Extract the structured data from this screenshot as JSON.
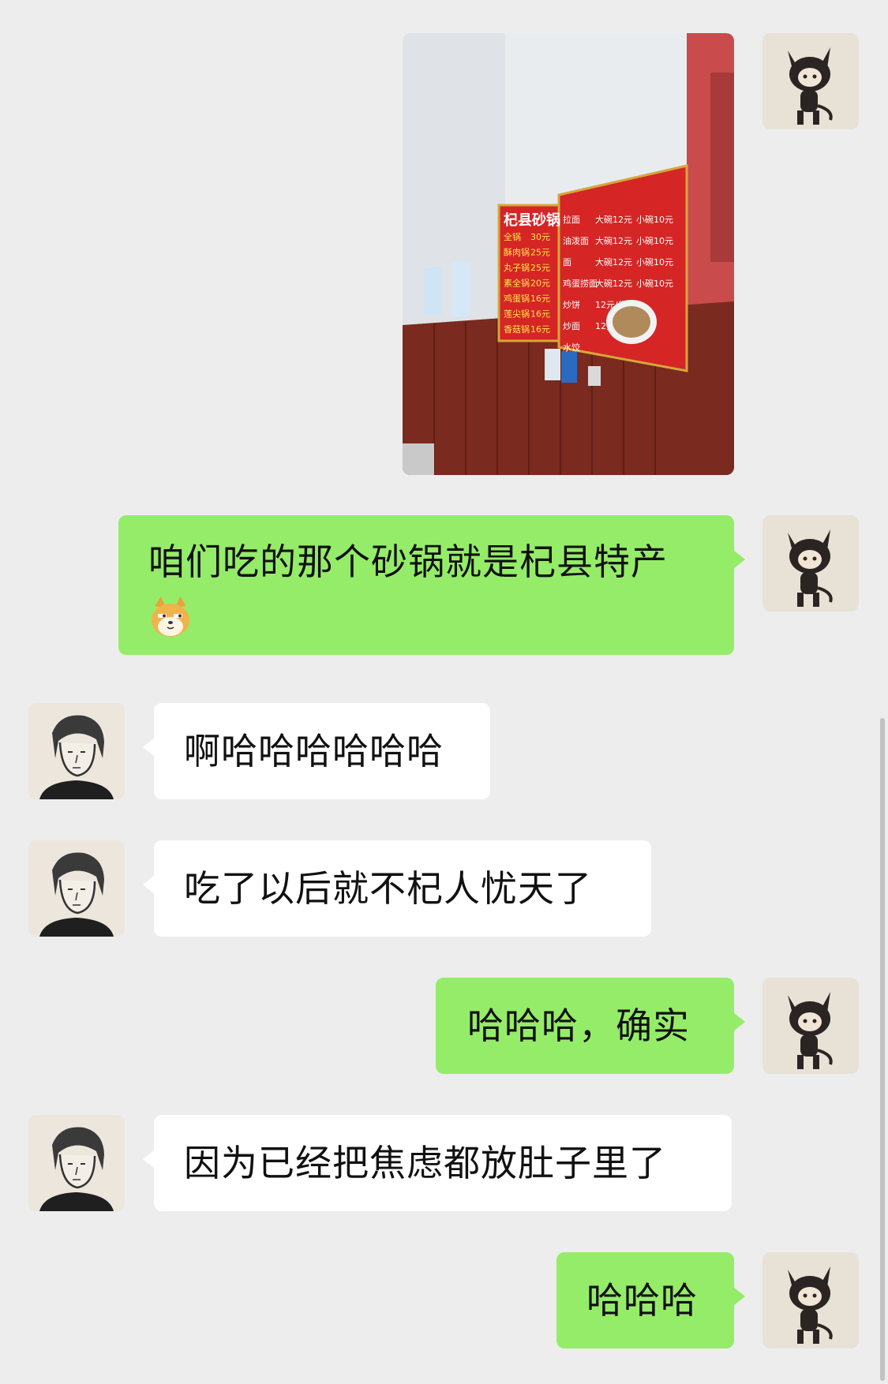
{
  "chat": {
    "messages": [
      {
        "sender": "me",
        "type": "image"
      },
      {
        "sender": "me",
        "type": "text",
        "text": "咱们吃的那个砂锅就是杞县特产",
        "emoji": "doge-emoji"
      },
      {
        "sender": "other",
        "type": "text",
        "text": "啊哈哈哈哈哈哈"
      },
      {
        "sender": "other",
        "type": "text",
        "text": "吃了以后就不杞人忧天了"
      },
      {
        "sender": "me",
        "type": "text",
        "text": "哈哈哈，确实"
      },
      {
        "sender": "other",
        "type": "text",
        "text": "因为已经把焦虑都放肚子里了"
      },
      {
        "sender": "me",
        "type": "text",
        "text": "哈哈哈"
      }
    ]
  },
  "photo_sign": {
    "left_title": "杞县砂锅",
    "left_items": [
      "全锅",
      "酥肉锅",
      "丸子锅",
      "素全锅",
      "鸡蛋锅",
      "莲尖锅",
      "香菇锅"
    ],
    "left_prices": [
      "30元",
      "25元",
      "25元",
      "20元",
      "16元",
      "16元",
      "16元"
    ],
    "right_items": [
      "拉面",
      "油泼面",
      "面",
      "鸡蛋捞面",
      "炒饼",
      "炒面",
      "水饺"
    ],
    "right_big": [
      "大碗12元",
      "大碗12元",
      "大碗12元",
      "大碗12元",
      "12元/份",
      "12元/份",
      ""
    ],
    "right_small": [
      "小碗10元",
      "小碗10元",
      "小碗10元",
      "小碗10元",
      "",
      "",
      ""
    ]
  },
  "colors": {
    "outgoing_bubble": "#95ec69",
    "incoming_bubble": "#ffffff",
    "background": "#ededed"
  }
}
